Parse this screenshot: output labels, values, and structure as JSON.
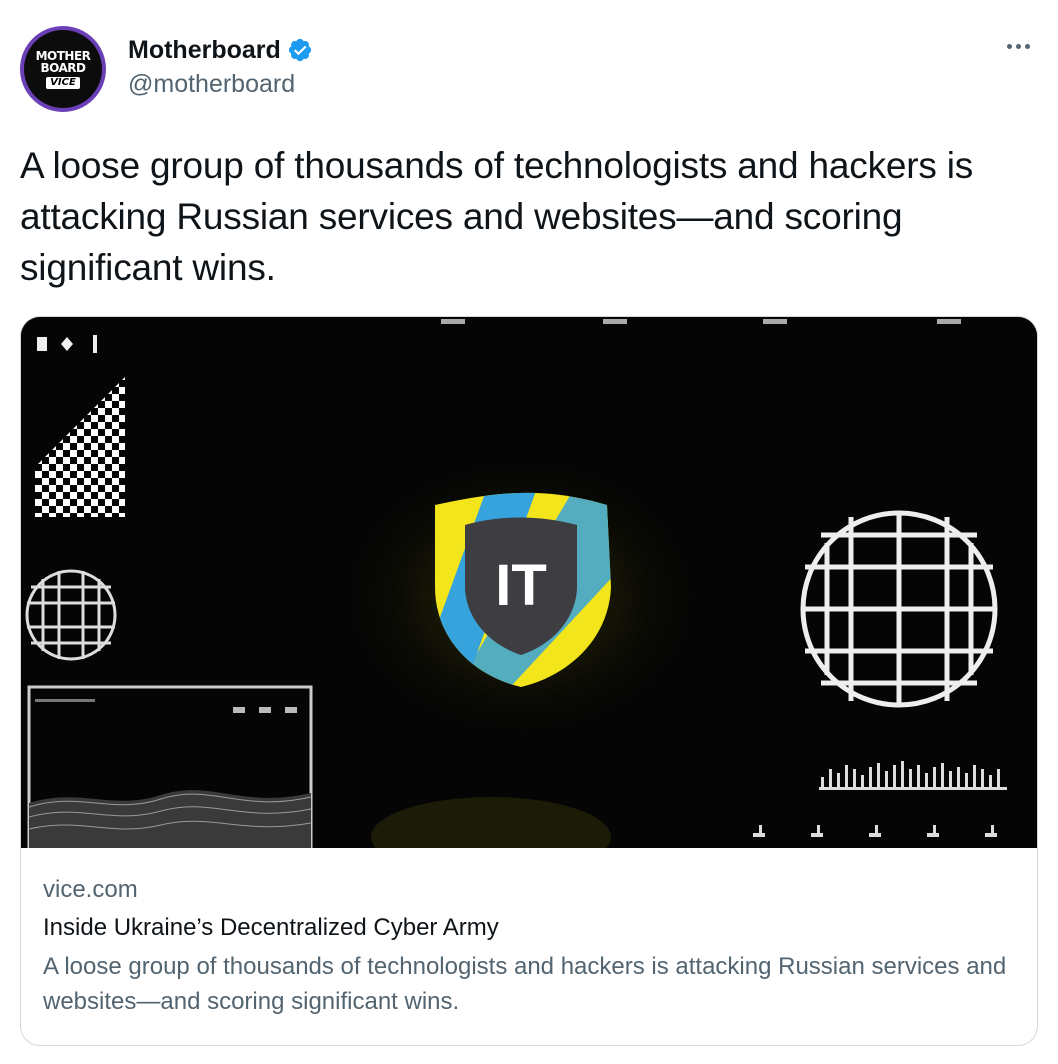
{
  "author": {
    "display_name": "Motherboard",
    "handle": "@motherboard",
    "verified_icon": "verified-badge-icon",
    "avatar": {
      "line1": "MOTHER",
      "line2": "BOARD",
      "line3": "VICE"
    }
  },
  "menu_icon": "more-options-icon",
  "tweet": {
    "text": "A loose group of thousands of technologists and hackers is attacking Russian services and websites—and scoring significant wins."
  },
  "card": {
    "image_label": "IT",
    "domain": "vice.com",
    "title": "Inside Ukraine’s Decentralized Cyber Army",
    "description": "A loose group of thousands of technologists and hackers is attacking Russian services and websites—and scoring significant wins."
  },
  "colors": {
    "verified": "#1d9bf0",
    "shield_yellow": "#f3e51b",
    "shield_blue": "#36a3dc",
    "avatar_ring": "#6b3fb6"
  }
}
